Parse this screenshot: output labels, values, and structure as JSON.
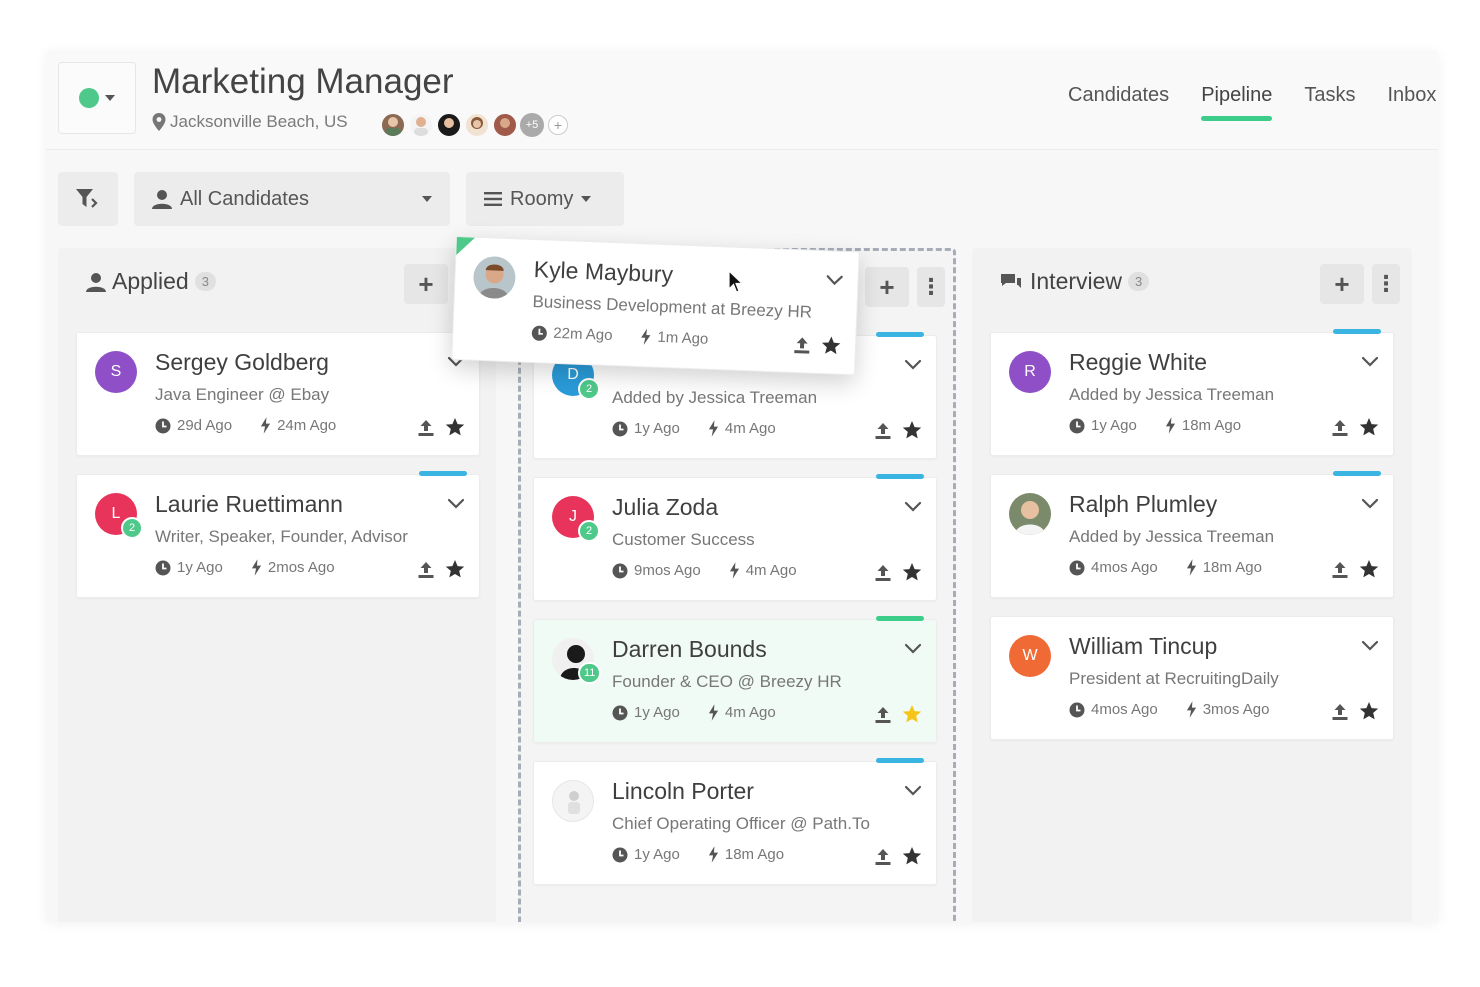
{
  "header": {
    "job_title": "Marketing Manager",
    "location": "Jacksonville Beach, US",
    "team_more": "+5",
    "team_add": "+",
    "status_color": "#4ec98a"
  },
  "nav": {
    "tabs": [
      {
        "label": "Candidates",
        "active": false
      },
      {
        "label": "Pipeline",
        "active": true
      },
      {
        "label": "Tasks",
        "active": false
      },
      {
        "label": "Inbox",
        "active": false
      }
    ],
    "accent": "#3ccd8a"
  },
  "toolbar": {
    "filter_icon": "filter-icon",
    "candidates_label": "All Candidates",
    "view_label": "Roomy"
  },
  "columns": {
    "applied": {
      "title": "Applied",
      "count": "3"
    },
    "interview": {
      "title": "Interview",
      "count": "3"
    }
  },
  "cards": {
    "sergey": {
      "initial": "S",
      "color": "#8e4fc7",
      "name": "Sergey Goldberg",
      "sub": "Java Engineer @ Ebay",
      "time1": "29d Ago",
      "time2": "24m Ago"
    },
    "laurie": {
      "initial": "L",
      "color": "#e8335a",
      "badge": "2",
      "name": "Laurie Ruettimann",
      "sub": "Writer, Speaker, Founder, Advisor",
      "time1": "1y Ago",
      "time2": "2mos Ago"
    },
    "dorsey": {
      "initial": "D",
      "color": "#2a9bd8",
      "badge": "2",
      "sub": "Added by Jessica Treeman",
      "time1": "1y Ago",
      "time2": "4m Ago"
    },
    "julia": {
      "initial": "J",
      "color": "#e8335a",
      "badge": "2",
      "name": "Julia Zoda",
      "sub": "Customer Success",
      "time1": "9mos Ago",
      "time2": "4m Ago"
    },
    "darren": {
      "badge": "11",
      "name": "Darren Bounds",
      "sub": "Founder & CEO @ Breezy HR",
      "time1": "1y Ago",
      "time2": "4m Ago"
    },
    "lincoln": {
      "name": "Lincoln Porter",
      "sub": "Chief Operating Officer @ Path.To",
      "time1": "1y Ago",
      "time2": "18m Ago"
    },
    "reggie": {
      "initial": "R",
      "color": "#8e4fc7",
      "name": "Reggie White",
      "sub": "Added by Jessica Treeman",
      "time1": "1y Ago",
      "time2": "18m Ago"
    },
    "ralph": {
      "name": "Ralph Plumley",
      "sub": "Added by Jessica Treeman",
      "time1": "4mos Ago",
      "time2": "18m Ago"
    },
    "william": {
      "initial": "W",
      "color": "#f06a35",
      "name": "William Tincup",
      "sub": "President at RecruitingDaily",
      "time1": "4mos Ago",
      "time2": "3mos Ago"
    }
  },
  "drag_card": {
    "name": "Kyle Maybury",
    "sub": "Business Development at Breezy HR",
    "time1": "22m Ago",
    "time2": "1m Ago"
  },
  "colors": {
    "stripe_blue": "#3ab4e0",
    "stripe_green": "#3ccd8a",
    "star_yellow": "#f5c518"
  }
}
